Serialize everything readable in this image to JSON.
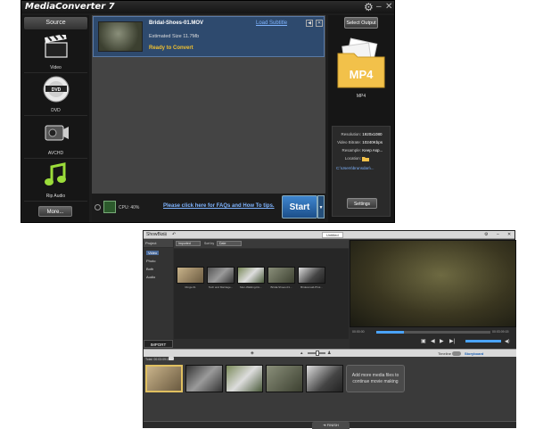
{
  "media_converter": {
    "title": "MediaConverter 7",
    "source_header": "Source",
    "source_items": [
      {
        "label": "Video",
        "icon": "clapperboard-icon"
      },
      {
        "label": "DVD",
        "icon": "dvd-disc-icon"
      },
      {
        "label": "AVCHD",
        "icon": "camcorder-icon"
      },
      {
        "label": "Rip Audio",
        "icon": "music-note-icon"
      }
    ],
    "more_label": "More...",
    "file": {
      "name": "Bridal-Shoes-01.MOV",
      "load_subtitle": "Load Subtitle",
      "estimated_size": "Estimated Size 11.7Mb",
      "status": "Ready to Convert"
    },
    "cpu_label": "CPU: 40%",
    "faq_link": "Please click here for FAQs and How To tips.",
    "start_label": "Start",
    "select_output_label": "Select Output",
    "output_format": "MP4",
    "output_format_label": "MP4",
    "settings": {
      "resolution_key": "Resolution:",
      "resolution_val": "1920x1080",
      "bitrate_key": "Video Bitrate:",
      "bitrate_val": "10240Kbps",
      "resample_key": "Resample:",
      "resample_val": "Keep Asp...",
      "location_key": "Location:",
      "path": "C:\\Users\\brunsdan\\..."
    },
    "settings_button": "Settings",
    "accent_color": "#2e4a6e",
    "status_color": "#f0c030"
  },
  "showbiz": {
    "title": "ShowBiz",
    "project_title": "Untitled",
    "project_label": "Project",
    "categories": [
      "Video",
      "Photo",
      "Both",
      "Audio"
    ],
    "import_label": "IMPORT",
    "filter_dropdown": "Imported",
    "sort_label": "Sort by",
    "sort_dropdown": "Date",
    "media_labels": [
      "Rings-01",
      "Tech and Marriage...",
      "Men-Walking-Do...",
      "Bridal-Shoes-01...",
      "Bridesmaid-Phot..."
    ],
    "preview_timecode_start": "00:00:00",
    "preview_timecode_end": "00:03:09:15",
    "view_labels": [
      "Timeline",
      "Storyboard"
    ],
    "active_view": "Storyboard",
    "timeline_header": "Total: 00:03:09:15",
    "add_more_text": "Add more media files to continue movie making",
    "finish_label": "FINISH"
  }
}
